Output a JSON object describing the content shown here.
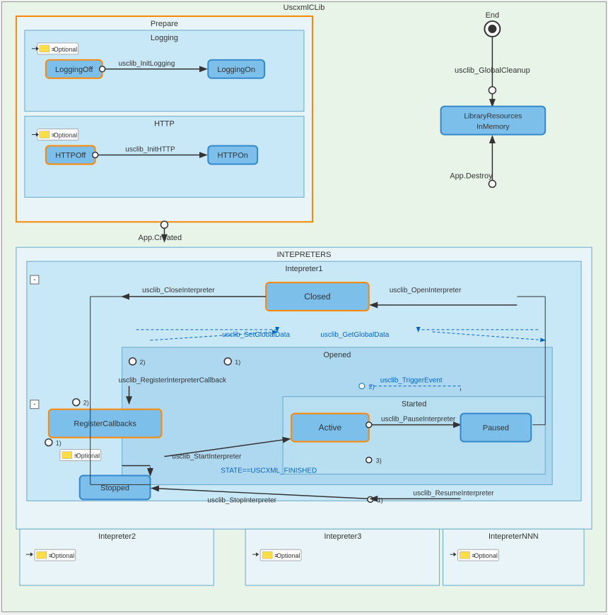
{
  "title": "UscxmlCLib",
  "prepare": {
    "label": "Prepare",
    "logging": {
      "label": "Logging",
      "optional": "Optional",
      "state_off": "LoggingOff",
      "state_on": "LoggingOn",
      "transition": "usclib_InitLogging"
    },
    "http": {
      "label": "HTTP",
      "optional": "Optional",
      "state_off": "HTTPOff",
      "state_on": "HTTPOn",
      "transition": "usclib_InitHTTP"
    }
  },
  "end": {
    "label": "End"
  },
  "app_created": "App.Created",
  "app_destroy": "App.Destroy",
  "global_cleanup": "usclib_GlobalCleanup",
  "lib_resources": "LibraryResourcesInMemory",
  "interpreters": {
    "label": "INTEPRETERS",
    "interpreter1": {
      "label": "Intepreter1",
      "state_closed": "Closed",
      "state_active": "Active",
      "state_paused": "Paused",
      "state_stopped": "Stopped",
      "section_opened": "Opened",
      "section_started": "Started",
      "register_callbacks": "RegisterCallbacks",
      "optional": "Optional",
      "transitions": {
        "close_interpreter": "usclib_CloseInterpreter",
        "open_interpreter": "usclib_OpenInterpreter",
        "set_global_data": "usclib_SetGlobalData",
        "get_global_data": "usclib_GetGlobalData",
        "trigger_event": "usclib_TriggerEvent",
        "register_callback": "usclib_RegisterInterpreterCallback",
        "start_interpreter": "usclib_StartInterpreter",
        "pause_interpreter": "usclib_PauseInterpreter",
        "resume_interpreter": "usclib_ResumeInterpreter",
        "stop_interpreter": "usclib_StopInterpreter",
        "state_finished": "STATE==USCXML_FINISHED"
      }
    },
    "interpreter2": {
      "label": "Intepreter2",
      "optional": "Optional"
    },
    "interpreter3": {
      "label": "Intepreter3",
      "optional": "Optional"
    },
    "interpreterNNN": {
      "label": "IntepreterNNN",
      "optional": "Optional"
    }
  }
}
